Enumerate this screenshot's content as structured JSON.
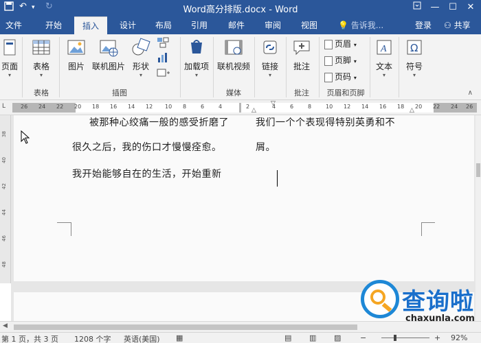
{
  "titlebar": {
    "title": "Word高分排版.docx - Word",
    "save_icon": "save-icon",
    "undo_icon": "undo-icon",
    "redo_icon": "redo-icon"
  },
  "tabs": [
    {
      "label": "文件"
    },
    {
      "label": "开始"
    },
    {
      "label": "插入",
      "active": true
    },
    {
      "label": "设计"
    },
    {
      "label": "布局"
    },
    {
      "label": "引用"
    },
    {
      "label": "邮件"
    },
    {
      "label": "审阅"
    },
    {
      "label": "视图"
    }
  ],
  "tellme": "告诉我...",
  "signin": "登录",
  "share": "共享",
  "ribbon": {
    "pages": {
      "label": "页面"
    },
    "table": {
      "label": "表格",
      "group": "表格"
    },
    "picture": {
      "label": "图片"
    },
    "online_picture": {
      "label": "联机图片"
    },
    "shapes": {
      "label": "形状"
    },
    "illustrations_group": "插图",
    "addins": {
      "label": "加载项"
    },
    "online_video": {
      "label": "联机视频"
    },
    "media_group": "媒体",
    "link": {
      "label": "链接"
    },
    "comment": {
      "label": "批注"
    },
    "comment_group": "批注",
    "header": {
      "label": "页眉"
    },
    "footer": {
      "label": "页脚"
    },
    "page_number": {
      "label": "页码"
    },
    "header_footer_group": "页眉和页脚",
    "text": {
      "label": "文本"
    },
    "symbols": {
      "label": "符号"
    }
  },
  "ruler": {
    "ticks": [
      "26",
      "24",
      "22",
      "20",
      "18",
      "16",
      "14",
      "12",
      "10",
      "8",
      "6",
      "4",
      "2",
      "2",
      "4",
      "6",
      "8",
      "10",
      "12",
      "14",
      "16",
      "18",
      "20",
      "22",
      "24",
      "26"
    ]
  },
  "vruler": {
    "ticks": [
      "38",
      "40",
      "42",
      "44",
      "46",
      "48"
    ]
  },
  "document": {
    "col1_line1": "被那种心绞痛一般的感受折磨了",
    "col1_line2": "很久之后，我的伤口才慢慢痊愈。",
    "col1_line3": "我开始能够自在的生活，开始重新",
    "col2_line1": "我们一个个表现得特别英勇和不",
    "col2_line2": "屑。"
  },
  "statusbar": {
    "page": "第 1 页，共 3 页",
    "words": "1208 个字",
    "language": "英语(美国)",
    "zoom": "92%"
  },
  "watermark": {
    "brand": "查询啦",
    "url": "chaxunla.com"
  }
}
